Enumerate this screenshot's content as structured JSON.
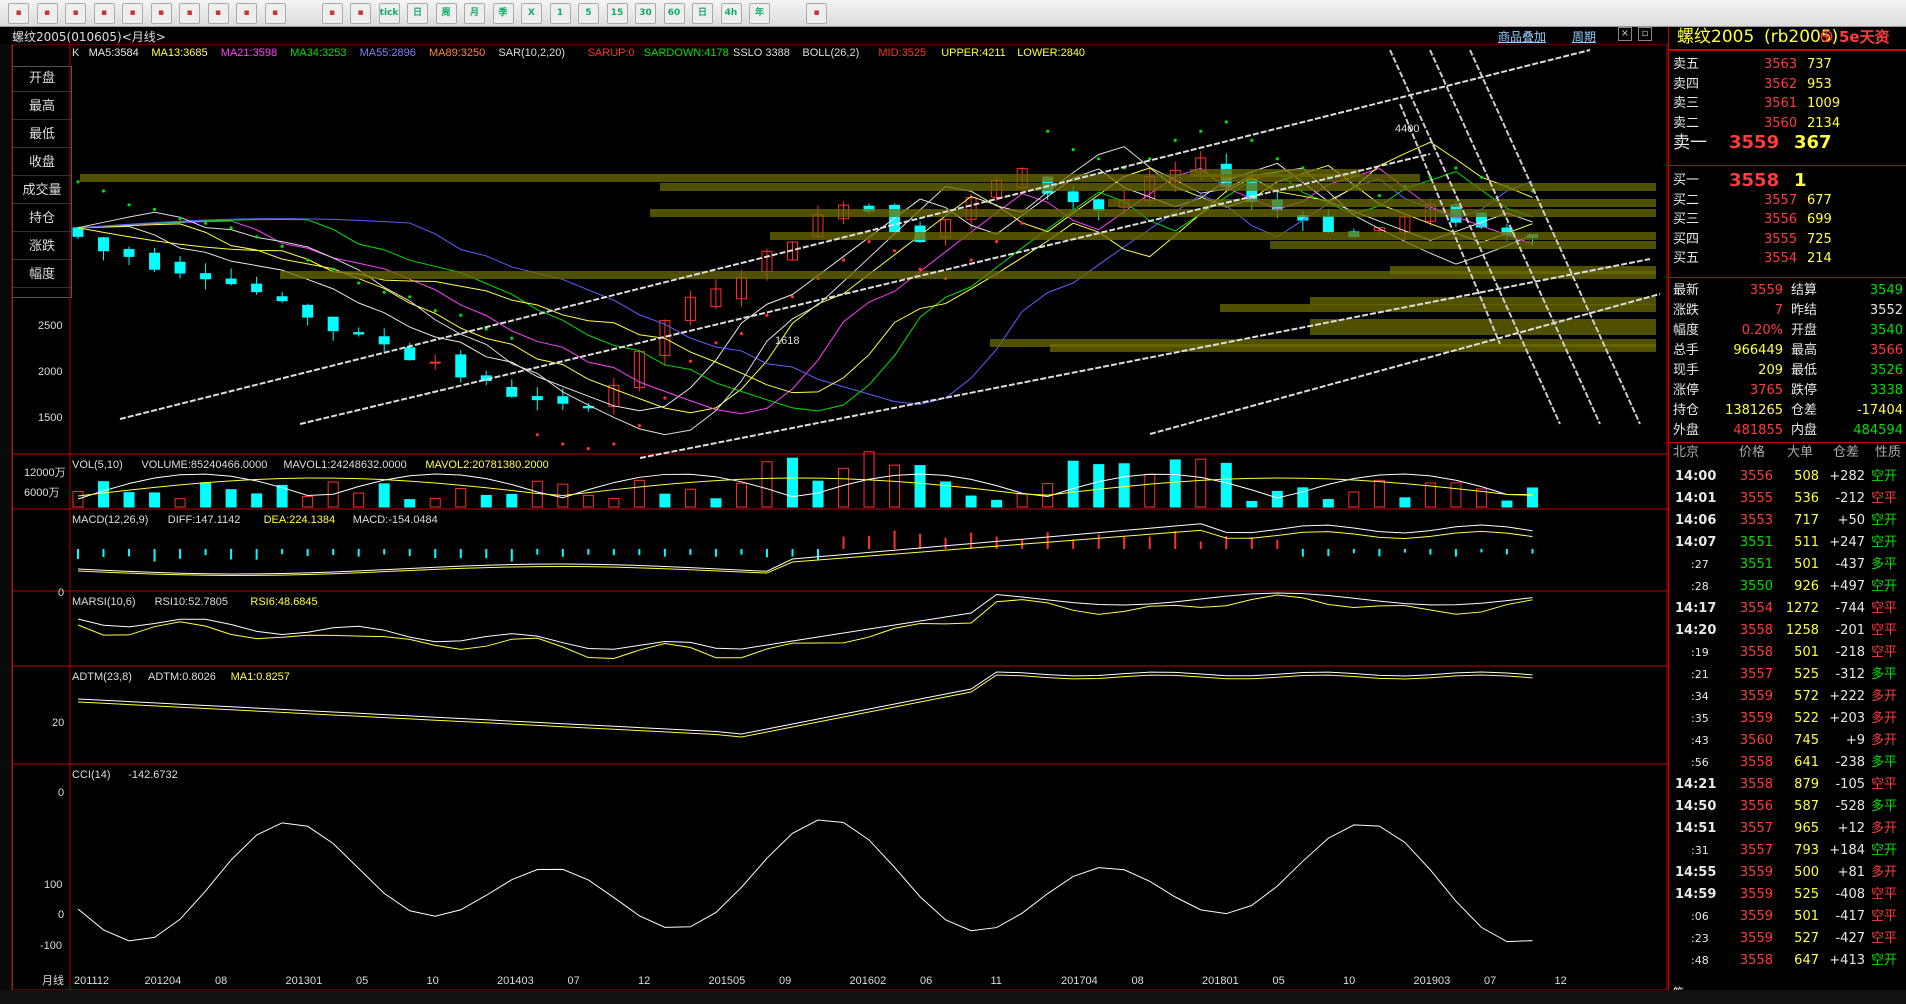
{
  "toolbar": {
    "icons": [
      "home-icon",
      "back-icon",
      "forward-icon",
      "zoom-in-icon",
      "zoom-out-icon",
      "search-icon",
      "draw-icon",
      "favorite-icon",
      "filter-icon",
      "share-icon",
      "table-icon",
      "line-chart-icon",
      "tick-icon",
      "day-icon",
      "week-icon",
      "month-icon",
      "season-icon",
      "x-icon",
      "k-icon",
      "five-icon",
      "fifteen-icon",
      "thirty-icon",
      "sixty-icon",
      "day2-icon",
      "four-h-icon",
      "year-icon",
      "calc-icon"
    ],
    "labels": [
      "",
      "",
      "",
      "",
      "",
      "",
      "",
      "",
      "",
      "",
      "",
      "",
      "tick",
      "日",
      "周",
      "月",
      "季",
      "X",
      "1",
      "5",
      "15",
      "30",
      "60",
      "日",
      "4h",
      "年",
      ""
    ]
  },
  "title": "螺纹2005(010605)<月线>",
  "top_links": {
    "overlay": "商品叠加",
    "period": "周期"
  },
  "left_buttons": [
    "开盘",
    "最高",
    "最低",
    "收盘",
    "成交量",
    "持仓",
    "涨跌",
    "幅度"
  ],
  "indicators": {
    "main_k": "K",
    "ma5": "MA5:3584",
    "ma13": "MA13:3685",
    "ma21": "MA21:3598",
    "ma34": "MA34:3253",
    "ma55": "MA55:2896",
    "ma89": "MA89:3250",
    "sar": "SAR(10,2,20)",
    "sarup": "SARUP:0",
    "sardown": "SARDOWN:4178",
    "sslo": "SSLO 3388",
    "boll": "BOLL(26,2)",
    "mid": "MID:3525",
    "upper": "UPPER:4211",
    "lower": "LOWER:2840",
    "vol": "VOL(5,10)",
    "volume": "VOLUME:85240466.0000",
    "mavol1": "MAVOL1:24248632.0000",
    "mavol2": "MAVOL2:20781380.2000",
    "macd": "MACD(12,26,9)",
    "diff": "DIFF:147.1142",
    "dea": "DEA:224.1384",
    "macdv": "MACD:-154.0484",
    "marsi": "MARSI(10,6)",
    "rsi10": "RSI10:52.7805",
    "rsi6": "RSI6:48.6845",
    "adtm": "ADTM(23,8)",
    "adtmv": "ADTM:0.8026",
    "ma1": "MA1:0.8257",
    "cci": "CCI(14)",
    "cciv": "-142.6732"
  },
  "axis": {
    "price_ticks": [
      "2500",
      "2000",
      "1500"
    ],
    "vol_ticks": [
      "12000万",
      "6000万"
    ],
    "macd_tick": "0",
    "rsi_tick": "20",
    "adtm_tick": "0",
    "cci_ticks": [
      "100",
      "0",
      "-100"
    ],
    "period_label": "月线",
    "dates": [
      "201112",
      "201204",
      "08",
      "201301",
      "05",
      "10",
      "201403",
      "07",
      "12",
      "201505",
      "09",
      "201602",
      "06",
      "11",
      "201704",
      "08",
      "201801",
      "05",
      "10",
      "201903",
      "07",
      "12"
    ],
    "annot_high": "4400",
    "annot_low": "1618"
  },
  "quote": {
    "name": "螺纹2005",
    "code": "(rb2005)",
    "logo": "5e天资",
    "asks": [
      {
        "label": "卖五",
        "price": "3563",
        "vol": "737"
      },
      {
        "label": "卖四",
        "price": "3562",
        "vol": "953"
      },
      {
        "label": "卖三",
        "price": "3561",
        "vol": "1009"
      },
      {
        "label": "卖二",
        "price": "3560",
        "vol": "2134"
      },
      {
        "label": "卖一",
        "price": "3559",
        "vol": "367"
      }
    ],
    "bids": [
      {
        "label": "买一",
        "price": "3558",
        "vol": "1"
      },
      {
        "label": "买二",
        "price": "3557",
        "vol": "677"
      },
      {
        "label": "买三",
        "price": "3556",
        "vol": "699"
      },
      {
        "label": "买四",
        "price": "3555",
        "vol": "725"
      },
      {
        "label": "买五",
        "price": "3554",
        "vol": "214"
      }
    ],
    "stats": [
      {
        "l1": "最新",
        "v1": "3559",
        "l2": "结算",
        "v2": "3549",
        "c1": "red",
        "c2": "grn"
      },
      {
        "l1": "涨跌",
        "v1": "7",
        "l2": "昨结",
        "v2": "3552",
        "c1": "red",
        "c2": "wht"
      },
      {
        "l1": "幅度",
        "v1": "0.20%",
        "l2": "开盘",
        "v2": "3540",
        "c1": "red",
        "c2": "grn"
      },
      {
        "l1": "总手",
        "v1": "966449",
        "l2": "最高",
        "v2": "3566",
        "c1": "yel",
        "c2": "red"
      },
      {
        "l1": "现手",
        "v1": "209",
        "l2": "最低",
        "v2": "3526",
        "c1": "yel",
        "c2": "grn"
      },
      {
        "l1": "涨停",
        "v1": "3765",
        "l2": "跌停",
        "v2": "3338",
        "c1": "red",
        "c2": "grn"
      },
      {
        "l1": "持仓",
        "v1": "1381265",
        "l2": "仓差",
        "v2": "-17404",
        "c1": "yel",
        "c2": "yel"
      },
      {
        "l1": "外盘",
        "v1": "481855",
        "l2": "内盘",
        "v2": "484594",
        "c1": "red",
        "c2": "grn"
      }
    ],
    "ticks_header": {
      "place": "北京",
      "price": "价格",
      "big": "大单",
      "diff": "仓差",
      "nature": "性质"
    },
    "ticks": [
      {
        "t": "14:00",
        "p": "3556",
        "v": "508",
        "d": "+282",
        "n": "空开",
        "pc": "red",
        "nc": "grn"
      },
      {
        "t": "14:01",
        "p": "3555",
        "v": "536",
        "d": "-212",
        "n": "空平",
        "pc": "red",
        "nc": "red"
      },
      {
        "t": "14:06",
        "p": "3553",
        "v": "717",
        "d": "+50",
        "n": "空开",
        "pc": "red",
        "nc": "grn"
      },
      {
        "t": "14:07",
        "p": "3551",
        "v": "511",
        "d": "+247",
        "n": "空开",
        "pc": "grn",
        "nc": "grn"
      },
      {
        "t": ":27",
        "p": "3551",
        "v": "501",
        "d": "-437",
        "n": "多平",
        "pc": "grn",
        "nc": "grn"
      },
      {
        "t": ":28",
        "p": "3550",
        "v": "926",
        "d": "+497",
        "n": "空开",
        "pc": "grn",
        "nc": "grn"
      },
      {
        "t": "14:17",
        "p": "3554",
        "v": "1272",
        "d": "-744",
        "n": "空平",
        "pc": "red",
        "nc": "red"
      },
      {
        "t": "14:20",
        "p": "3558",
        "v": "1258",
        "d": "-201",
        "n": "空平",
        "pc": "red",
        "nc": "red"
      },
      {
        "t": ":19",
        "p": "3558",
        "v": "501",
        "d": "-218",
        "n": "空平",
        "pc": "red",
        "nc": "red"
      },
      {
        "t": ":21",
        "p": "3557",
        "v": "525",
        "d": "-312",
        "n": "多平",
        "pc": "red",
        "nc": "grn"
      },
      {
        "t": ":34",
        "p": "3559",
        "v": "572",
        "d": "+222",
        "n": "多开",
        "pc": "red",
        "nc": "red"
      },
      {
        "t": ":35",
        "p": "3559",
        "v": "522",
        "d": "+203",
        "n": "多开",
        "pc": "red",
        "nc": "red"
      },
      {
        "t": ":43",
        "p": "3560",
        "v": "745",
        "d": "+9",
        "n": "多开",
        "pc": "red",
        "nc": "red"
      },
      {
        "t": ":56",
        "p": "3558",
        "v": "641",
        "d": "-238",
        "n": "多平",
        "pc": "red",
        "nc": "grn"
      },
      {
        "t": "14:21",
        "p": "3558",
        "v": "879",
        "d": "-105",
        "n": "空平",
        "pc": "red",
        "nc": "red"
      },
      {
        "t": "14:50",
        "p": "3556",
        "v": "587",
        "d": "-528",
        "n": "多平",
        "pc": "red",
        "nc": "grn"
      },
      {
        "t": "14:51",
        "p": "3557",
        "v": "965",
        "d": "+12",
        "n": "多开",
        "pc": "red",
        "nc": "red"
      },
      {
        "t": ":31",
        "p": "3557",
        "v": "793",
        "d": "+184",
        "n": "空开",
        "pc": "red",
        "nc": "grn"
      },
      {
        "t": "14:55",
        "p": "3559",
        "v": "500",
        "d": "+81",
        "n": "多开",
        "pc": "red",
        "nc": "red"
      },
      {
        "t": "14:59",
        "p": "3559",
        "v": "525",
        "d": "-408",
        "n": "空平",
        "pc": "red",
        "nc": "red"
      },
      {
        "t": ":06",
        "p": "3559",
        "v": "501",
        "d": "-417",
        "n": "空平",
        "pc": "red",
        "nc": "red"
      },
      {
        "t": ":23",
        "p": "3559",
        "v": "527",
        "d": "-427",
        "n": "空平",
        "pc": "red",
        "nc": "red"
      },
      {
        "t": ":48",
        "p": "3558",
        "v": "647",
        "d": "+413",
        "n": "空开",
        "pc": "red",
        "nc": "grn"
      }
    ],
    "footer": "笔"
  },
  "colors": {
    "up": "#ff3030",
    "down": "#00ffff",
    "ma5": "#e8e8e8",
    "ma13": "#ffff40",
    "ma21": "#ff40ff",
    "ma34": "#00e000",
    "ma55": "#6060ff",
    "ma89": "#ff8040",
    "accent": "#cc0000"
  }
}
